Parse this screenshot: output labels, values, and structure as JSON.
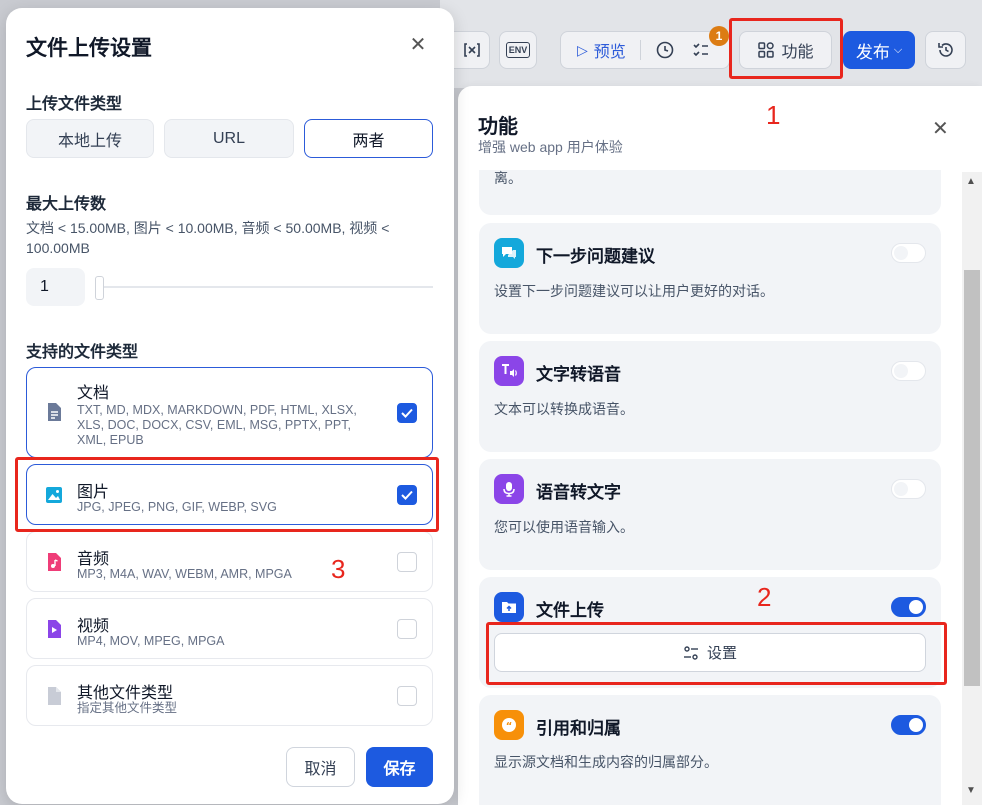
{
  "toolbar": {
    "env_label": "ENV",
    "preview_label": "预览",
    "badge_count": "1",
    "features_label": "功能",
    "publish_label": "发布"
  },
  "modal": {
    "title": "文件上传设置",
    "upload_type_heading": "上传文件类型",
    "upload_types": [
      {
        "label": "本地上传",
        "selected": false
      },
      {
        "label": "URL",
        "selected": false
      },
      {
        "label": "两者",
        "selected": true
      }
    ],
    "max_uploads_heading": "最大上传数",
    "limits_text": "文档 < 15.00MB, 图片 < 10.00MB, 音频 < 50.00MB, 视频 < 100.00MB",
    "max_uploads_value": "1",
    "max_uploads_slider_fraction": 0,
    "supported_heading": "支持的文件类型",
    "file_types": [
      {
        "name": "文档",
        "extensions": "TXT, MD, MDX, MARKDOWN, PDF, HTML, XLSX, XLS, DOC, DOCX, CSV, EML, MSG, PPTX, PPT, XML, EPUB",
        "checked": true,
        "icon": "document-icon",
        "color": "#6b7a99"
      },
      {
        "name": "图片",
        "extensions": "JPG, JPEG, PNG, GIF, WEBP, SVG",
        "checked": true,
        "icon": "image-icon",
        "color": "#14a8db"
      },
      {
        "name": "音频",
        "extensions": "MP3, M4A, WAV, WEBM, AMR, MPGA",
        "checked": false,
        "icon": "audio-icon",
        "color": "#ef3d78"
      },
      {
        "name": "视频",
        "extensions": "MP4, MOV, MPEG, MPGA",
        "checked": false,
        "icon": "video-icon",
        "color": "#8b45e8"
      },
      {
        "name": "其他文件类型",
        "extensions": "指定其他文件类型",
        "checked": false,
        "icon": "other-file-icon",
        "color": "#c8ccd6"
      }
    ],
    "cancel_label": "取消",
    "save_label": "保存"
  },
  "panel": {
    "title": "功能",
    "subtitle": "增强 web app 用户体验",
    "truncated_text": "让对话显得更加自然，让 AI 主动说第一段话可以拉近与用户间的距离。",
    "features": [
      {
        "title": "下一步问题建议",
        "desc": "设置下一步问题建议可以让用户更好的对话。",
        "enabled": false,
        "icon": "chat-bubbles-icon",
        "color": "#14a8db"
      },
      {
        "title": "文字转语音",
        "desc": "文本可以转换成语音。",
        "enabled": false,
        "icon": "text-to-speech-icon",
        "color": "#8b45e8"
      },
      {
        "title": "语音转文字",
        "desc": "您可以使用语音输入。",
        "enabled": false,
        "icon": "microphone-icon",
        "color": "#8b45e8"
      },
      {
        "title": "文件上传",
        "desc": "",
        "enabled": true,
        "icon": "folder-upload-icon",
        "color": "#1d5ae0",
        "settings_label": "设置"
      },
      {
        "title": "引用和归属",
        "desc": "显示源文档和生成内容的归属部分。",
        "enabled": true,
        "icon": "quote-icon",
        "color": "#f79009"
      }
    ]
  },
  "annotations": {
    "n1": "1",
    "n2": "2",
    "n3": "3",
    "color": "#e8261d"
  }
}
